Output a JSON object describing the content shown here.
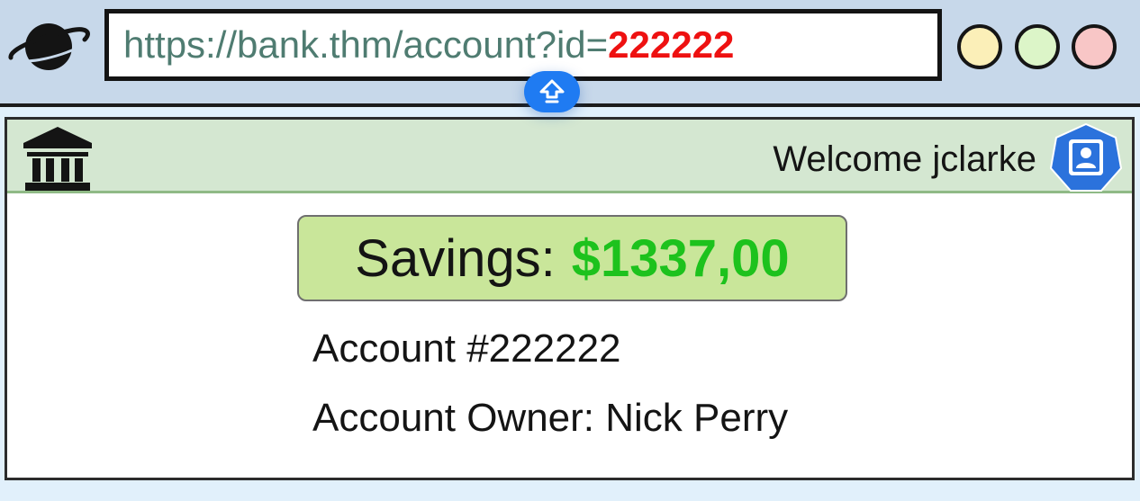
{
  "browser": {
    "logo_icon": "planet-icon",
    "url": {
      "base": "https://bank.thm/account?id=",
      "id_param": "222222"
    },
    "window_controls": [
      {
        "name": "minimize",
        "color": "#fbefb8"
      },
      {
        "name": "maximize",
        "color": "#dcf5c8"
      },
      {
        "name": "close",
        "color": "#f8c6c6"
      }
    ],
    "edit_badge_icon": "upload-arrow-icon"
  },
  "site": {
    "logo_icon": "bank-building-icon",
    "welcome_text": "Welcome jclarke",
    "user_icon": "user-profile-icon",
    "header_color": "#d4e7d1"
  },
  "account": {
    "balance_label": "Savings:",
    "balance_value": "$1337,00",
    "number_text": "Account #222222",
    "owner_text": "Account Owner: Nick Perry"
  },
  "colors": {
    "url_text": "#4f7c71",
    "url_param": "#ee1111",
    "balance_value": "#1dc21d",
    "balance_box": "#c9e69a",
    "edit_badge": "#1f7bf2"
  }
}
